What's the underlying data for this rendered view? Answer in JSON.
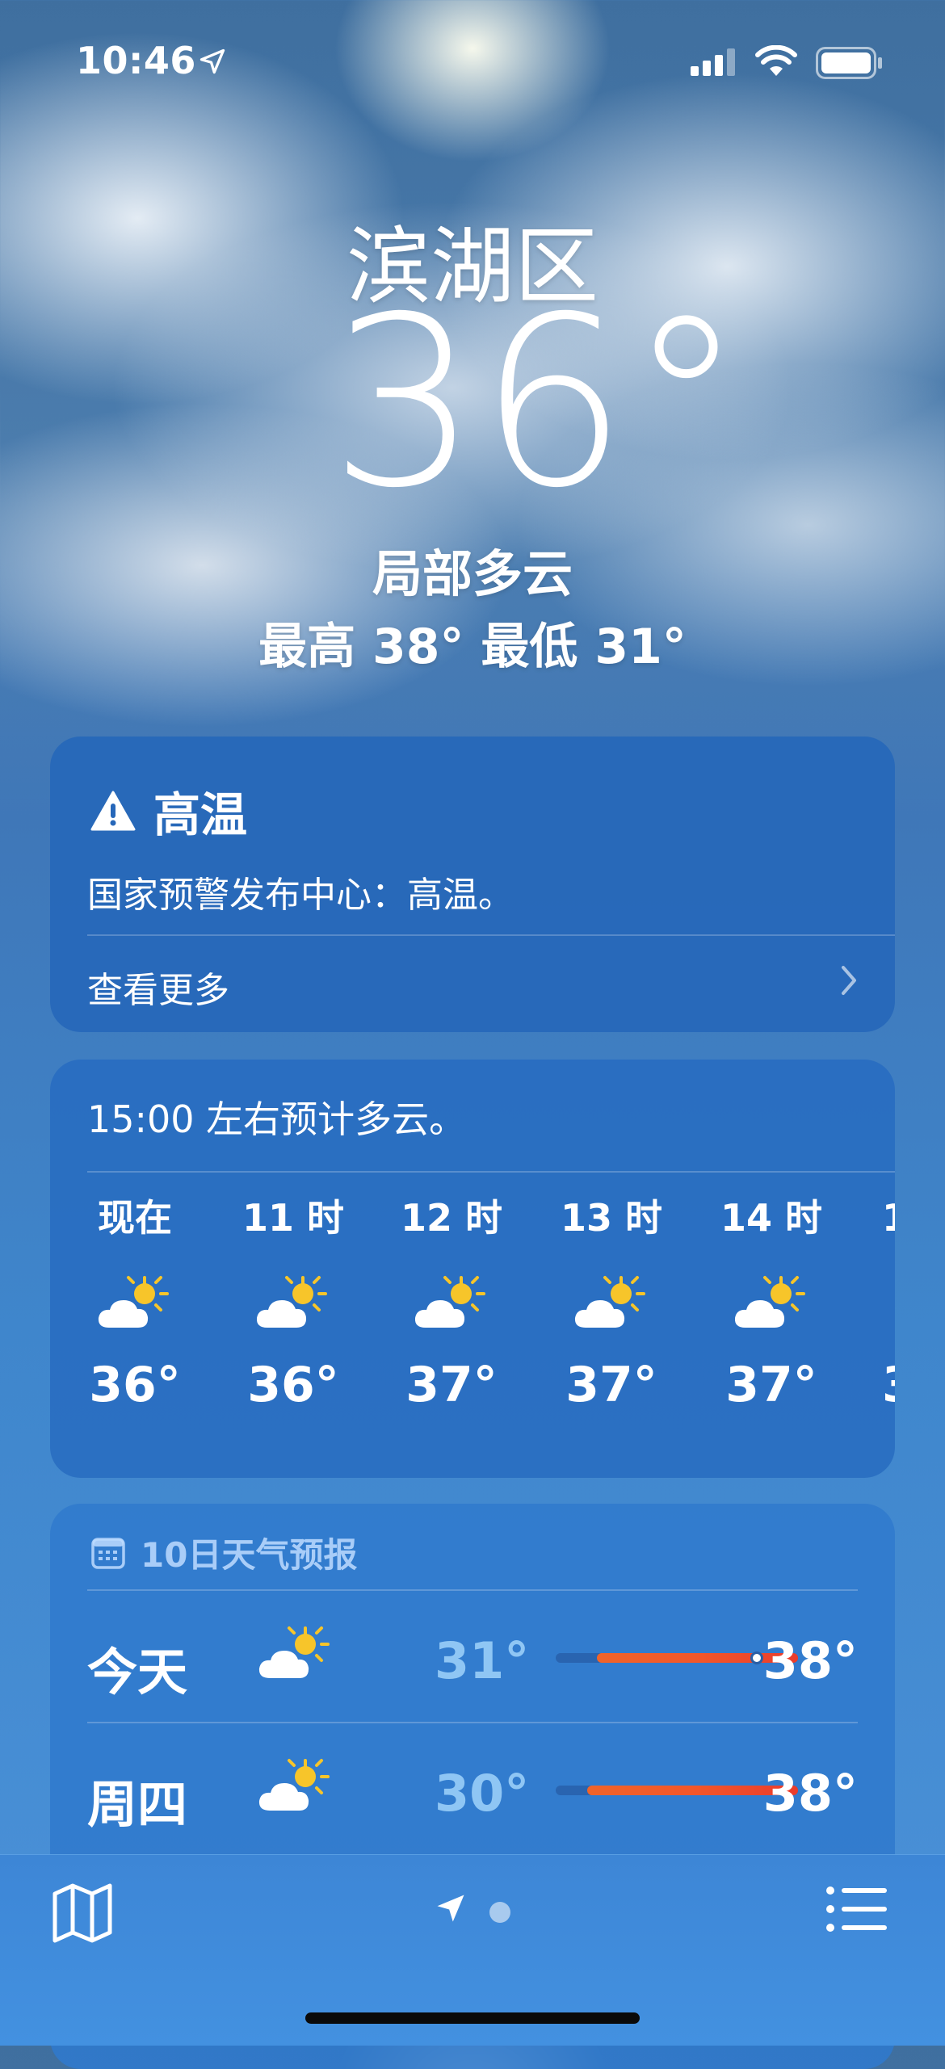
{
  "status_bar": {
    "time": "10:46"
  },
  "header": {
    "city": "滨湖区",
    "temperature": "36°",
    "condition": "局部多云",
    "high_low": "最高 38°  最低 31°"
  },
  "alert_card": {
    "title": "高温",
    "body": "国家预警发布中心：高温。",
    "more_label": "查看更多"
  },
  "hourly_card": {
    "summary": "15:00 左右预计多云。",
    "hours": [
      {
        "label": "现在",
        "temp": "36°",
        "icon": "partly-sunny-icon"
      },
      {
        "label": "11 时",
        "temp": "36°",
        "icon": "partly-sunny-icon"
      },
      {
        "label": "12 时",
        "temp": "37°",
        "icon": "partly-sunny-icon"
      },
      {
        "label": "13 时",
        "temp": "37°",
        "icon": "partly-sunny-icon"
      },
      {
        "label": "14 时",
        "temp": "37°",
        "icon": "partly-sunny-icon"
      },
      {
        "label": "1",
        "temp": "3",
        "icon": ""
      }
    ]
  },
  "ten_day_card": {
    "header": "10日天气预报",
    "rows": [
      {
        "day": "今天",
        "low": "31°",
        "high": "38°",
        "icon": "partly-sunny-icon",
        "range_start": 0.17,
        "range_end": 1.0,
        "current": 0.83
      },
      {
        "day": "周四",
        "low": "30°",
        "high": "38°",
        "icon": "partly-sunny-icon",
        "range_start": 0.13,
        "range_end": 1.0
      }
    ]
  },
  "colors": {
    "sky_top": "#3f6f9f",
    "sky_bottom": "#4b92d9",
    "low_temp": "#8fc6f4",
    "range_bar": "#f2572a",
    "sun": "#f7c52a"
  }
}
